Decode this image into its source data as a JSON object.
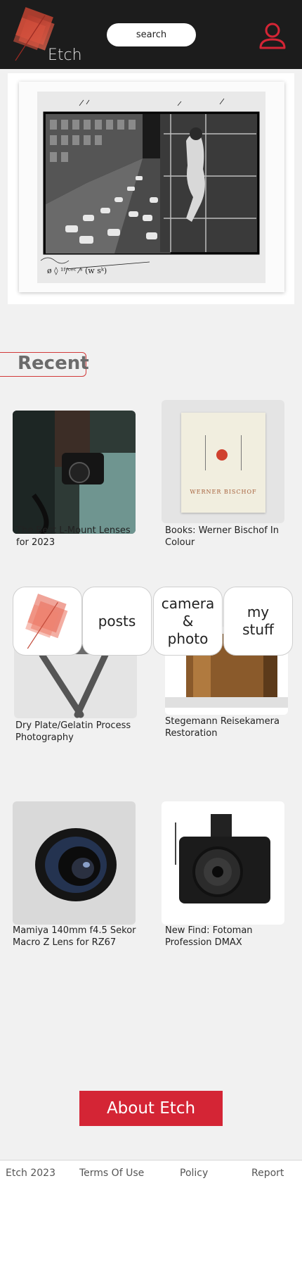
{
  "header": {
    "brand": "Etch",
    "search_placeholder": "search"
  },
  "recent": {
    "heading": "Recent"
  },
  "posts": [
    {
      "title": "The Best L-Mount Lenses for 2023"
    },
    {
      "title": "Books: Werner Bischof In Colour",
      "book_cover_text": "WERNER BISCHOF"
    },
    {
      "title": "Dry Plate/Gelatin Process Photography"
    },
    {
      "title": "Stegemann Reisekamera Restoration"
    },
    {
      "title": "Mamiya 140mm f4.5 Sekor Macro Z Lens for RZ67"
    },
    {
      "title": "New Find: Fotoman Profession DMAX"
    }
  ],
  "nav": {
    "posts": "posts",
    "camera_photo_line1": "camera",
    "camera_photo_line2": "&",
    "camera_photo_line3": "photo",
    "my_stuff_line1": "my",
    "my_stuff_line2": "stuff"
  },
  "about_button": "About Etch",
  "footer": {
    "copyright": "Etch 2023",
    "terms": "Terms Of Use",
    "policy": "Policy",
    "report": "Report"
  },
  "colors": {
    "accent": "#d42535",
    "header_bg": "#1c1c1c",
    "page_bg": "#f1f1f1"
  }
}
